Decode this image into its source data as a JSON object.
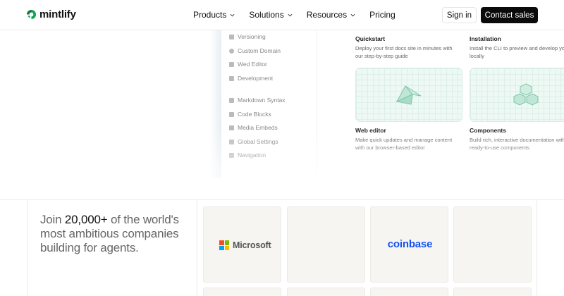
{
  "nav": {
    "brand": "mintlify",
    "menu": [
      {
        "label": "Products",
        "has_dropdown": true
      },
      {
        "label": "Solutions",
        "has_dropdown": true
      },
      {
        "label": "Resources",
        "has_dropdown": true
      },
      {
        "label": "Pricing",
        "has_dropdown": false
      }
    ],
    "sign_in": "Sign in",
    "contact_sales": "Contact sales"
  },
  "preview": {
    "sidebar_items": [
      {
        "label": "Versioning",
        "icon": "versioning-icon"
      },
      {
        "label": "Custom Domain",
        "icon": "globe-icon"
      },
      {
        "label": "Wed Editor",
        "icon": "pen-icon"
      },
      {
        "label": "Development",
        "icon": "code-icon"
      },
      {
        "label": "Markdown Syntax",
        "icon": "markdown-icon"
      },
      {
        "label": "Code Blocks",
        "icon": "code-block-icon"
      },
      {
        "label": "Media Embeds",
        "icon": "media-icon"
      },
      {
        "label": "Global Settings",
        "icon": "settings-icon"
      },
      {
        "label": "Navigation",
        "icon": "navigation-icon"
      }
    ],
    "cards": [
      {
        "title": "Quickstart",
        "description": "Deploy your first docs site in minutes with our step-by-step guide"
      },
      {
        "title": "Installation",
        "description": "Install the CLI to preview and develop your docs locally"
      },
      {
        "title": "Web editor",
        "description": "Make quick updates and manage content with our browser-based editor"
      },
      {
        "title": "Components",
        "description": "Build rich, interactive documentation with our ready-to-use components"
      }
    ]
  },
  "customers": {
    "join_prefix": "Join",
    "join_count": "20,000+",
    "join_rest": "of the world's most ambitious companies building for agents.",
    "logos": [
      "Microsoft",
      "coinbase"
    ]
  },
  "colors": {
    "accent": "#0b0b0b",
    "brand_green": "#16a34a",
    "coinbase_blue": "#1652f0",
    "tile_bg": "#f6f5f2"
  }
}
